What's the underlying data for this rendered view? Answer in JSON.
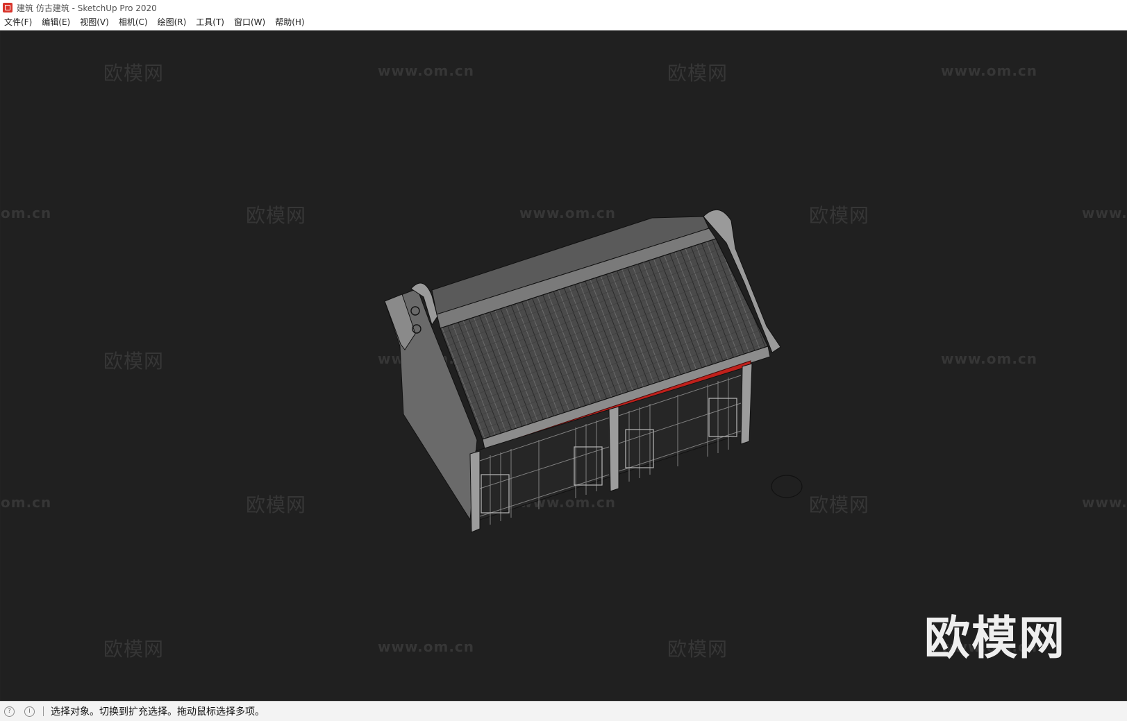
{
  "window": {
    "title": "建筑 仿古建筑 - SketchUp Pro 2020"
  },
  "menu": [
    {
      "label": "文件(F)"
    },
    {
      "label": "编辑(E)"
    },
    {
      "label": "视图(V)"
    },
    {
      "label": "相机(C)"
    },
    {
      "label": "绘图(R)"
    },
    {
      "label": "工具(T)"
    },
    {
      "label": "窗口(W)"
    },
    {
      "label": "帮助(H)"
    }
  ],
  "watermarks": {
    "cn": "欧模网",
    "url": "www.om.cn",
    "url_partial_left": "om.cn",
    "url_partial_right": "www."
  },
  "brand_logo_text": "欧模网",
  "status": {
    "message": "选择对象。切换到扩充选择。拖动鼠标选择多项。"
  },
  "colors": {
    "viewport_bg": "#202020",
    "roof": "#4a4a4a",
    "wall": "#6e6e6e",
    "beam": "#c0201b"
  }
}
